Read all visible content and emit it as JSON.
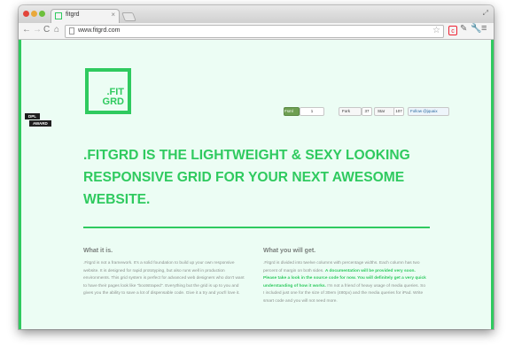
{
  "browser": {
    "tab_title": "fitgrd",
    "tab_close": "×",
    "url": "www.fitgrd.com",
    "nav": {
      "back": "←",
      "forward": "→",
      "reload": "C",
      "home": "⌂"
    },
    "extension_label": "c"
  },
  "ribbon": {
    "line1": "DPL",
    "line2": "AWARD"
  },
  "logo": {
    "line1": ".FIT",
    "line2": "GRD"
  },
  "social": {
    "facebook_label": "Fsml",
    "facebook_count": "1",
    "fork_label": "Fork",
    "fork_count": "37",
    "star_label": "Star",
    "star_count": "107",
    "twitter_label": "Follow @jquaix"
  },
  "headline": ".FITGRD IS THE LIGHTWEIGHT & SEXY LOOKING RESPONSIVE GRID FOR YOUR NEXT AWESOME WEBSITE.",
  "left_column": {
    "title": "What it is.",
    "text": ".Fitgrd is not a framework. It's a solid foundation to build up your own responsive website. It is designed for rapid prototyping, but also runs well in production environments. This grid system is perfect for advanced web designers who don't want to have their pages look like \"bootstraped\". Everything but the grid is up to you and gives you the ability to save a lot of dispensable code. Give it a try and you'll love it."
  },
  "right_column": {
    "title": "What you will get.",
    "text_1": ".Fitgrd is divided into twelve columns with percentage widths. Each column has two percent of margin on both sides.",
    "text_highlight": "A documentation will be provided very soon. Please take a look in the source code for now. You will definitely get a very quick understanding of how it works.",
    "text_2": "I'm not a friend of heavy usage of media queries. So I included just one for the size of 30em (480px) and the media queries for iPad. Write smart code and you will not need more."
  },
  "colors": {
    "brand_green": "#2fca5f",
    "background": "#ecfdf4"
  }
}
